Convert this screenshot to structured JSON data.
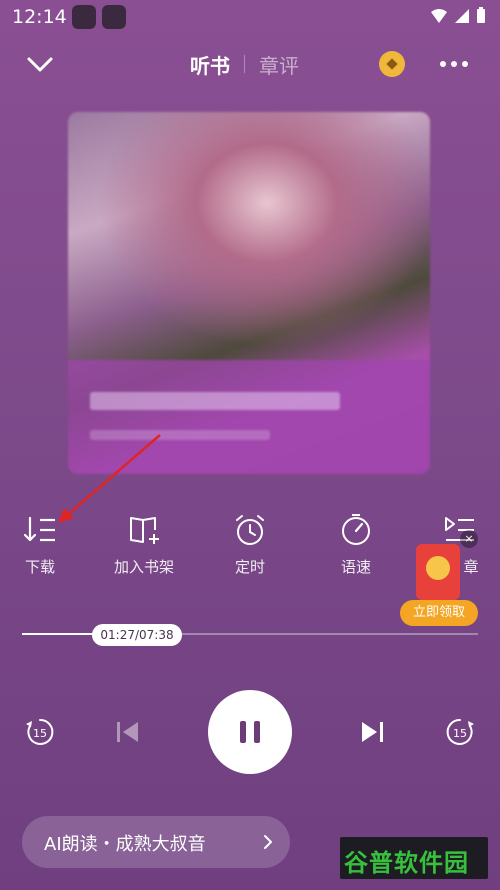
{
  "status": {
    "time": "12:14"
  },
  "header": {
    "tabs": [
      {
        "label": "听书",
        "active": true
      },
      {
        "label": "章评",
        "active": false
      }
    ]
  },
  "actions": [
    {
      "label": "下载",
      "icon": "download-list-icon"
    },
    {
      "label": "加入书架",
      "icon": "bookshelf-add-icon"
    },
    {
      "label": "定时",
      "icon": "alarm-clock-icon"
    },
    {
      "label": "语速",
      "icon": "speed-gauge-icon"
    },
    {
      "label": "章",
      "icon": "chapter-list-icon"
    }
  ],
  "redpacket": {
    "button_label": "立即领取",
    "close_label": "×"
  },
  "progress": {
    "time_label": "01:27/07:38",
    "fraction": 0.19
  },
  "controls": {
    "back15_label": "15",
    "fwd15_label": "15"
  },
  "voice": {
    "label": "AI朗读・成熟大叔音"
  },
  "watermark": {
    "text": "谷普软件园"
  },
  "colors": {
    "background": "#7d4a8a",
    "accent_orange": "#f5a524",
    "coin_gold": "#f0b83a",
    "redpacket_red": "#e8413b"
  }
}
